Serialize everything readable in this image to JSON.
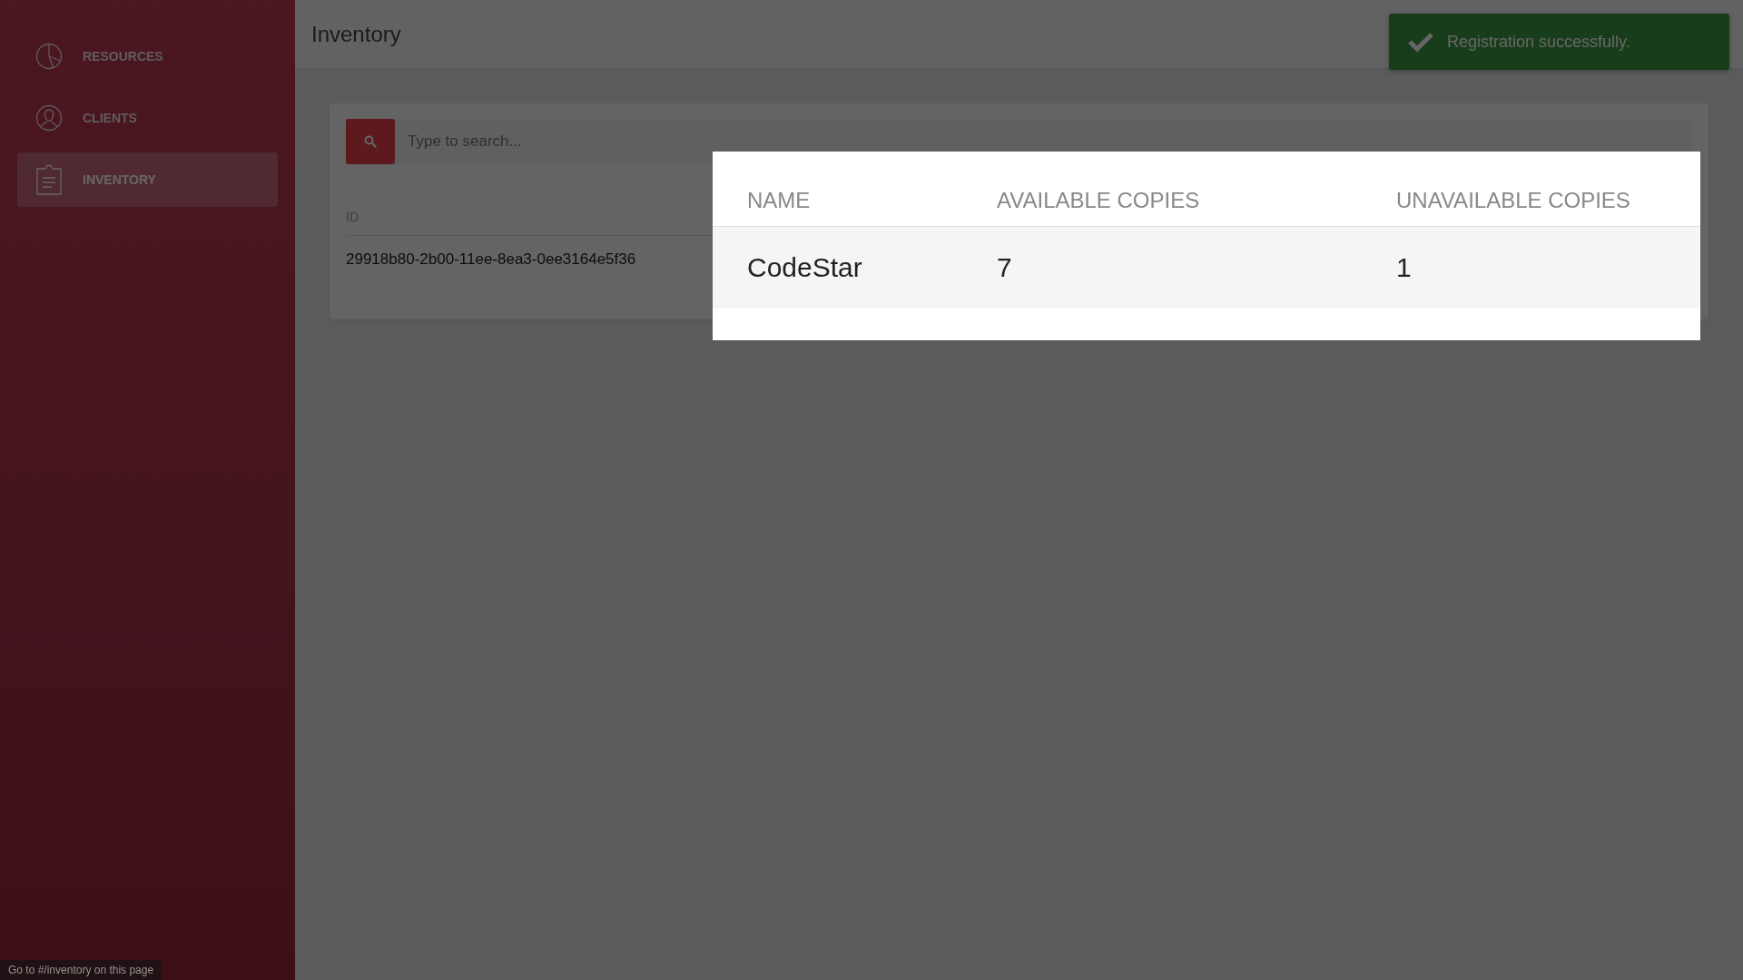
{
  "sidebar": {
    "items": [
      {
        "label": "RESOURCES",
        "selected": false
      },
      {
        "label": "CLIENTS",
        "selected": false
      },
      {
        "label": "INVENTORY",
        "selected": true
      }
    ]
  },
  "header": {
    "title": "Inventory"
  },
  "search": {
    "placeholder": "Type to search..."
  },
  "table": {
    "columns": [
      "ID"
    ],
    "rows": [
      [
        "29918b80-2b00-11ee-8ea3-0ee3164e5f36"
      ]
    ]
  },
  "toast": {
    "message": "Registration successfully."
  },
  "modal": {
    "columns": [
      "NAME",
      "AVAILABLE COPIES",
      "UNAVAILABLE COPIES"
    ],
    "rows": [
      [
        "CodeStar",
        "7",
        "1"
      ]
    ]
  },
  "status_bar": {
    "text": "Go to #/inventory on this page"
  }
}
